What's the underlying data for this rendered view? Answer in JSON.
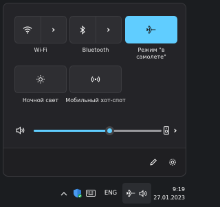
{
  "quick_settings": {
    "tiles": [
      {
        "id": "wifi",
        "label": "Wi-Fi",
        "active": false,
        "icon": "wifi-icon",
        "has_chevron": true
      },
      {
        "id": "bluetooth",
        "label": "Bluetooth",
        "active": false,
        "icon": "bluetooth-icon",
        "has_chevron": true
      },
      {
        "id": "airplane",
        "label": "Режим \"в самолете\"",
        "active": true,
        "icon": "airplane-icon"
      },
      {
        "id": "night_light",
        "label": "Ночной свет",
        "active": false,
        "icon": "brightness-icon"
      },
      {
        "id": "mobile_hotspot",
        "label": "Мобильный хот-спот",
        "active": false,
        "icon": "hotspot-icon"
      }
    ],
    "volume": {
      "level": 0.59,
      "icon": "speaker-icon"
    },
    "footer": {
      "edit_icon": "pencil-icon",
      "settings_icon": "gear-icon"
    }
  },
  "taskbar": {
    "language": "ENG",
    "time": "9:19",
    "date": "27.01.2023",
    "icons": [
      "chevron-up-icon",
      "defender-icon",
      "keyboard-icon",
      "airplane-icon",
      "speaker-icon"
    ]
  },
  "colors": {
    "accent": "#60cdff",
    "panel": "#242428",
    "tile": "#2e2e32"
  }
}
